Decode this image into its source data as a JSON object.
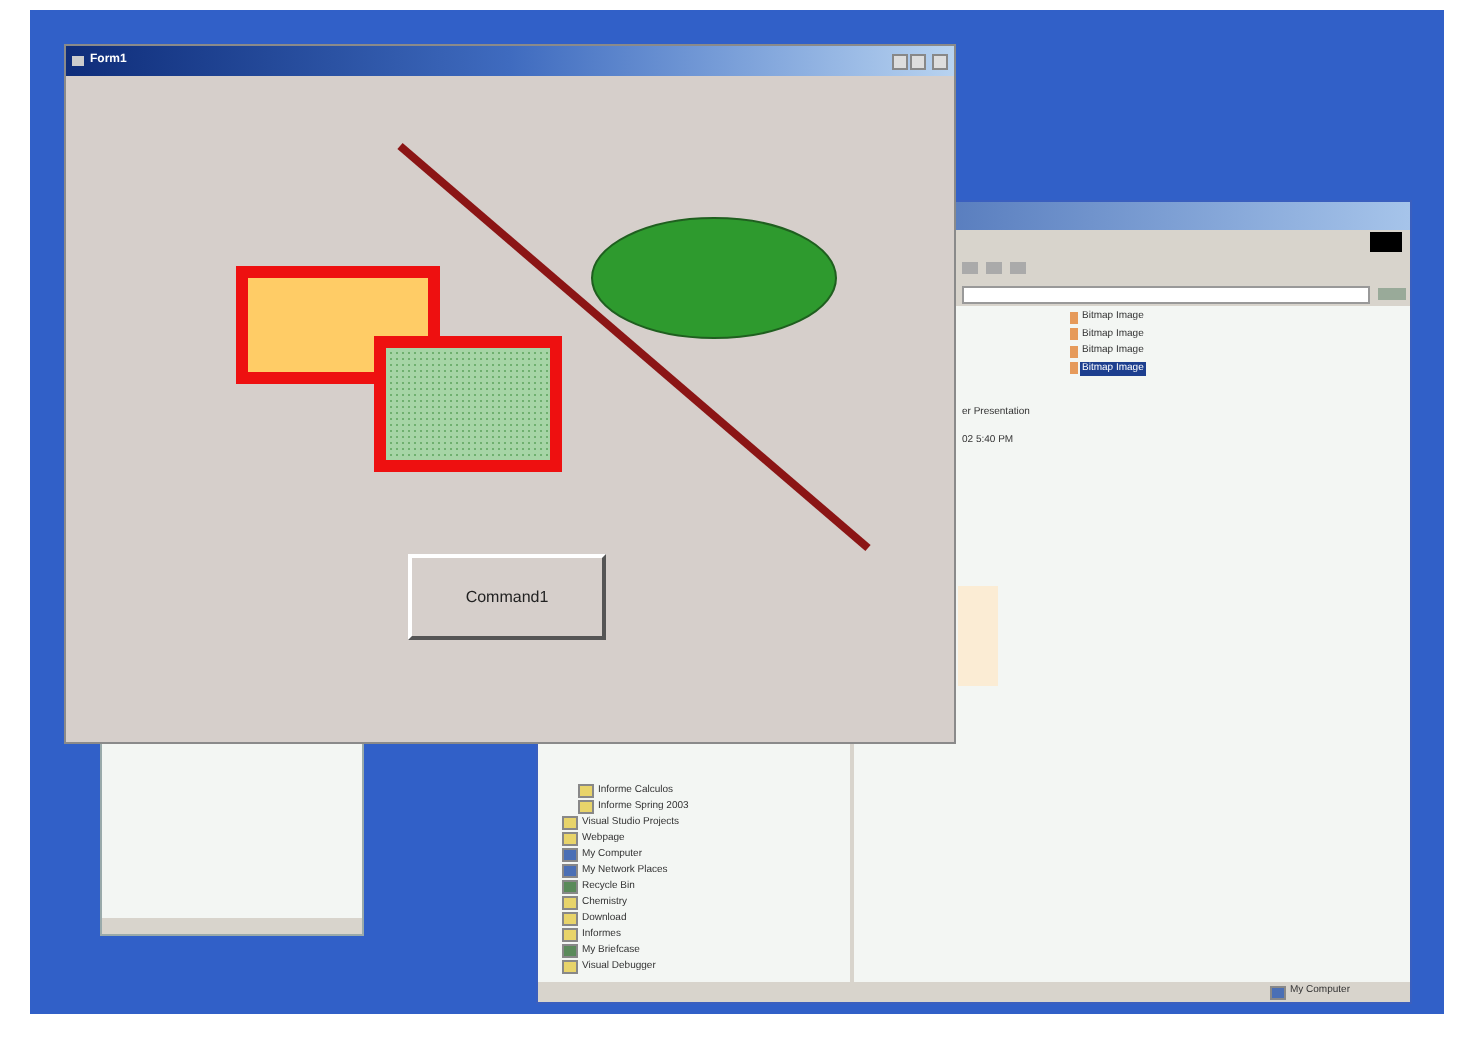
{
  "form": {
    "title": "Form1",
    "command_button": "Command1"
  },
  "explorer": {
    "files": [
      {
        "name": "Bitmap Image",
        "selected": false
      },
      {
        "name": "Bitmap Image",
        "selected": false
      },
      {
        "name": "Bitmap Image",
        "selected": false
      },
      {
        "name": "Bitmap Image",
        "selected": true
      }
    ],
    "details": [
      "er Presentation",
      "02 5:40 PM"
    ],
    "tree_nested": [
      {
        "label": "Informe Calculos"
      },
      {
        "label": "Informe Spring 2003"
      }
    ],
    "tree": [
      {
        "label": "Visual Studio Projects",
        "kind": "folder"
      },
      {
        "label": "Webpage",
        "kind": "folder"
      },
      {
        "label": "My Computer",
        "kind": "computer"
      },
      {
        "label": "My Network Places",
        "kind": "computer"
      },
      {
        "label": "Recycle Bin",
        "kind": "bin"
      },
      {
        "label": "Chemistry",
        "kind": "folder"
      },
      {
        "label": "Download",
        "kind": "folder"
      },
      {
        "label": "Informes",
        "kind": "folder"
      },
      {
        "label": "My Briefcase",
        "kind": "bin"
      },
      {
        "label": "Visual Debugger",
        "kind": "folder"
      }
    ],
    "status_location": "My Computer"
  }
}
